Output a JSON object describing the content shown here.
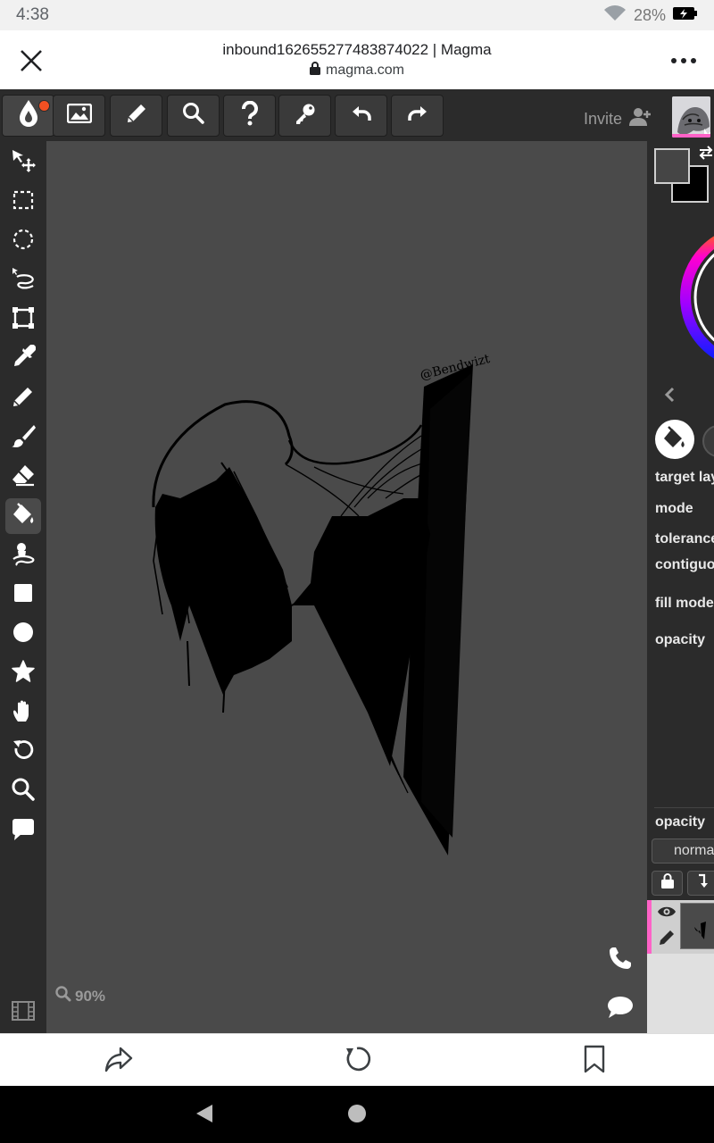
{
  "status_bar": {
    "time": "4:38",
    "battery": "28%"
  },
  "browser": {
    "page_title": "inbound162655277483874022 | Magma",
    "url": "magma.com"
  },
  "toolbar": {
    "invite_label": "Invite"
  },
  "canvas": {
    "zoom": "90%",
    "signature": "@Bendwizt",
    "background_color": "#4a4a4a"
  },
  "tool_options": {
    "target_layer": "target lay",
    "mode": "mode",
    "tolerance": "tolerance",
    "contiguous": "contiguou",
    "fill_mode": "fill mode",
    "opacity": "opacity"
  },
  "layers": {
    "opacity_label": "opacity",
    "blend_mode": "norma"
  },
  "colors": {
    "accent": "#ff62c7",
    "notification": "#f25022",
    "primary_color": "#454545",
    "secondary_color": "#000000"
  },
  "icons": {
    "tools": [
      "move-icon",
      "rect-select-icon",
      "ellipse-select-icon",
      "lasso-icon",
      "transform-icon",
      "eyedropper-icon",
      "pencil-icon",
      "brush-icon",
      "eraser-icon",
      "paint-bucket-icon",
      "smudge-icon",
      "rectangle-icon",
      "circle-icon",
      "star-icon",
      "hand-icon",
      "rotate-icon",
      "zoom-icon",
      "comment-icon",
      "film-icon"
    ]
  }
}
